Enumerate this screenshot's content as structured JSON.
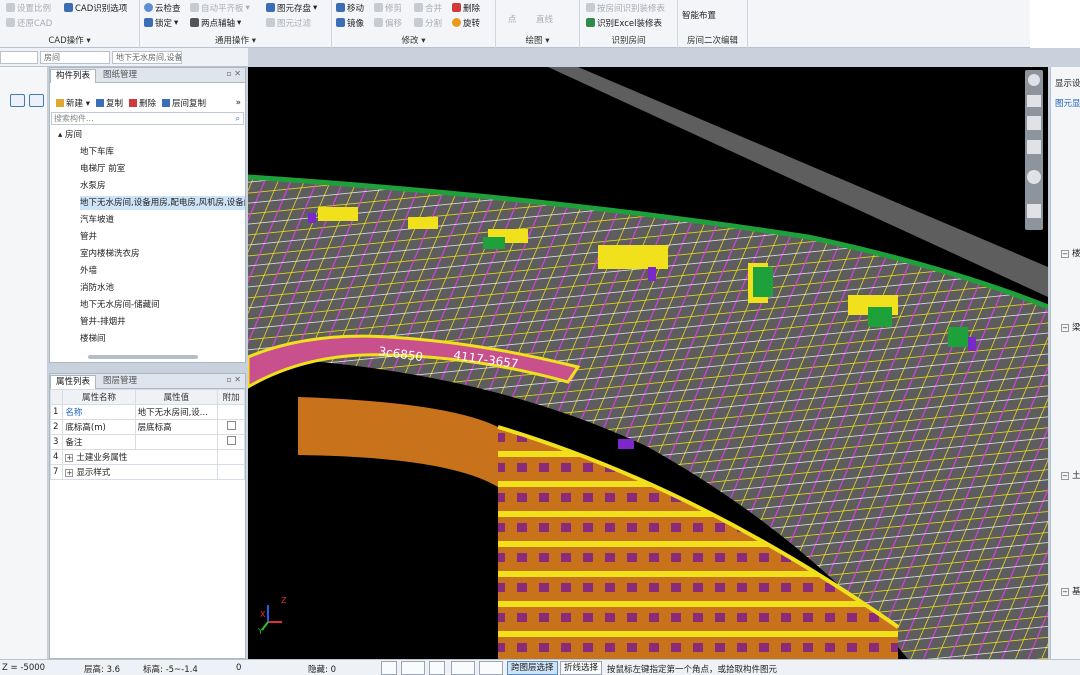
{
  "ribbon": {
    "cad_ops": {
      "items": [
        "设置比例",
        "还原CAD",
        "CAD识别选项"
      ],
      "label": "CAD操作"
    },
    "general_ops": {
      "items": [
        "云检查",
        "自动平齐板",
        "图元存盘",
        "锁定",
        "两点辅轴",
        "图元过滤"
      ],
      "label": "通用操作"
    },
    "modify": {
      "items": [
        "移动",
        "修剪",
        "删除",
        "镜像",
        "偏移",
        "合并",
        "分割",
        "旋转"
      ],
      "label": "修改"
    },
    "draw": {
      "items": [
        "点",
        "直线"
      ],
      "label": "绘图"
    },
    "identify_room": {
      "items": [
        "按房间识别装修表",
        "识别Excel装修表"
      ],
      "label": "识别房间"
    },
    "room_edit": {
      "items": [
        "智能布置"
      ],
      "label": "房间二次编辑"
    }
  },
  "selectors": {
    "floor": "",
    "type": "房间",
    "component": "地下无水房间,设备"
  },
  "component_panel": {
    "tabs": [
      "构件列表",
      "图纸管理"
    ],
    "toolbar": [
      "新建",
      "复制",
      "删除",
      "层间复制"
    ],
    "search_placeholder": "搜索构件...",
    "root": "房间",
    "items": [
      "地下车库",
      "电梯厅 前室",
      "水泵房",
      "地下无水房间,设备用房,配电房,风机房,设备间",
      "汽车坡道",
      "管井",
      "室内楼梯洗衣房",
      "外墙",
      "消防水池",
      "地下无水房间-储藏间",
      "管井-排烟井",
      "楼梯间"
    ],
    "selected_index": 3
  },
  "property_panel": {
    "tabs": [
      "属性列表",
      "图层管理"
    ],
    "headers": [
      "属性名称",
      "属性值",
      "附加"
    ],
    "rows": [
      {
        "no": "1",
        "name": "名称",
        "value": "地下无水房间,设...",
        "check": false
      },
      {
        "no": "2",
        "name": "底标高(m)",
        "value": "层底标高",
        "check": true
      },
      {
        "no": "3",
        "name": "备注",
        "value": "",
        "check": true
      },
      {
        "no": "4",
        "name": "土建业务属性",
        "value": "",
        "check": false,
        "expand": true
      },
      {
        "no": "7",
        "name": "显示样式",
        "value": "",
        "check": false,
        "expand": true
      }
    ]
  },
  "viewport": {
    "labels": [
      "3c6850",
      "4117-3657"
    ],
    "axis": {
      "x": "X",
      "y": "Y",
      "z": "Z"
    },
    "colors": {
      "bg": "#000000",
      "slab": "#6b6b6b",
      "wall": "#c8731c",
      "line_yellow": "#f0e11c",
      "line_magenta": "#e03ce8",
      "green": "#1ea03a",
      "purple": "#7a28c8",
      "road": "#c8508c",
      "white": "#ffffff"
    }
  },
  "right_panel": {
    "title": "显示设",
    "tab": "图元显",
    "sections": [
      "楼",
      "梁",
      "土",
      "基"
    ]
  },
  "status": {
    "z": "Z = -5000",
    "floor_height": "层高: 3.6",
    "elevation": "标高: -5~-1.4",
    "count": "0",
    "hidden": "隐藏: 0",
    "cross_select": "跨图层选择",
    "poly_select": "折线选择",
    "hint": "按鼠标左键指定第一个角点，或拾取构件图元"
  }
}
